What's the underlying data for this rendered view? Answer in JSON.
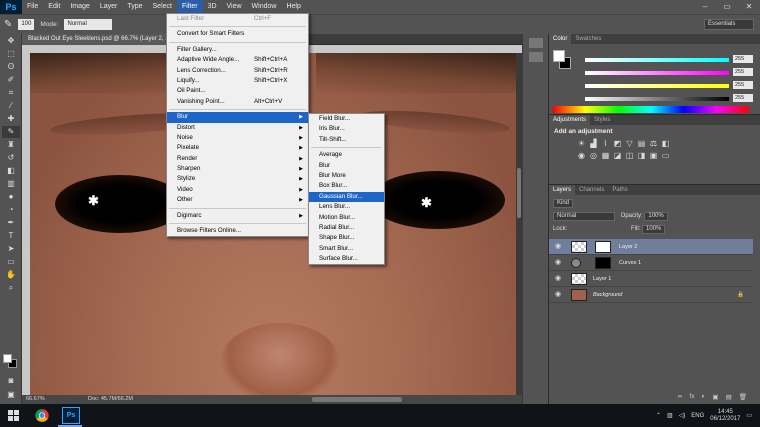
{
  "app": {
    "logo": "Ps",
    "window_controls": [
      "–",
      "▭",
      "✕"
    ]
  },
  "menubar": [
    "File",
    "Edit",
    "Image",
    "Layer",
    "Type",
    "Select",
    "Filter",
    "3D",
    "View",
    "Window",
    "Help"
  ],
  "options": {
    "brush_size": "100",
    "mode_label": "Mode:",
    "mode_value": "Normal",
    "workspace": "Essentials"
  },
  "document": {
    "tab_title": "Blacked Out Eye Sleeklens.psd @ 66.7% (Layer 2, ...",
    "zoom": "66.67%",
    "doc_info": "Doc: 45.7M/66.2M"
  },
  "filter_menu": {
    "items": [
      {
        "label": "Last Filter",
        "shortcut": "Ctrl+F",
        "disabled": true
      },
      {
        "sep": true
      },
      {
        "label": "Convert for Smart Filters"
      },
      {
        "sep": true
      },
      {
        "label": "Filter Gallery..."
      },
      {
        "label": "Adaptive Wide Angle...",
        "shortcut": "Shift+Ctrl+A"
      },
      {
        "label": "Lens Correction...",
        "shortcut": "Shift+Ctrl+R"
      },
      {
        "label": "Liquify...",
        "shortcut": "Shift+Ctrl+X"
      },
      {
        "label": "Oil Paint..."
      },
      {
        "label": "Vanishing Point...",
        "shortcut": "Alt+Ctrl+V"
      },
      {
        "sep": true
      },
      {
        "label": "Blur",
        "submenu": true,
        "highlighted": true
      },
      {
        "label": "Distort",
        "submenu": true
      },
      {
        "label": "Noise",
        "submenu": true
      },
      {
        "label": "Pixelate",
        "submenu": true
      },
      {
        "label": "Render",
        "submenu": true
      },
      {
        "label": "Sharpen",
        "submenu": true
      },
      {
        "label": "Stylize",
        "submenu": true
      },
      {
        "label": "Video",
        "submenu": true
      },
      {
        "label": "Other",
        "submenu": true
      },
      {
        "sep": true
      },
      {
        "label": "Digimarc",
        "submenu": true
      },
      {
        "sep": true
      },
      {
        "label": "Browse Filters Online..."
      }
    ]
  },
  "blur_menu": {
    "items": [
      {
        "label": "Field Blur..."
      },
      {
        "label": "Iris Blur..."
      },
      {
        "label": "Tilt-Shift..."
      },
      {
        "sep": true
      },
      {
        "label": "Average"
      },
      {
        "label": "Blur"
      },
      {
        "label": "Blur More"
      },
      {
        "label": "Box Blur..."
      },
      {
        "label": "Gaussian Blur...",
        "highlighted": true
      },
      {
        "label": "Lens Blur..."
      },
      {
        "label": "Motion Blur..."
      },
      {
        "label": "Radial Blur..."
      },
      {
        "label": "Shape Blur..."
      },
      {
        "label": "Smart Blur..."
      },
      {
        "label": "Surface Blur..."
      }
    ]
  },
  "color_panel": {
    "tabs": [
      "Color",
      "Swatches"
    ],
    "sliders": [
      {
        "label": "",
        "value": "255",
        "color": "#00ffff"
      },
      {
        "label": "",
        "value": "255",
        "color": "#ff00ff"
      },
      {
        "label": "",
        "value": "255",
        "color": "#ffff00"
      },
      {
        "label": "",
        "value": "255",
        "color": "#000000"
      }
    ]
  },
  "adjustments_panel": {
    "tabs": [
      "Adjustments",
      "Styles"
    ],
    "title": "Add an adjustment"
  },
  "layers_panel": {
    "tabs": [
      "Layers",
      "Channels",
      "Paths"
    ],
    "kind_label": "Kind",
    "blend_mode": "Normal",
    "opacity_label": "Opacity:",
    "opacity": "100%",
    "lock_label": "Lock:",
    "fill_label": "Fill:",
    "fill": "100%",
    "layers": [
      {
        "name": "Layer 2",
        "selected": true
      },
      {
        "name": "Curves 1"
      },
      {
        "name": "Layer 1"
      },
      {
        "name": "Background",
        "locked": true
      }
    ],
    "footer_icons": [
      "∞",
      "fx",
      "◐",
      "▣",
      "▤",
      "🗑"
    ]
  },
  "taskbar": {
    "language": "ENG",
    "time": "14:45",
    "date": "06/12/2017"
  }
}
